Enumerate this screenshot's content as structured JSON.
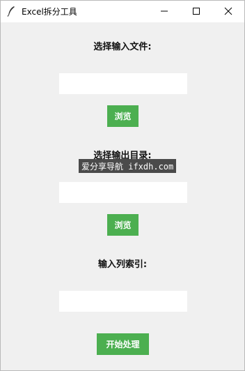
{
  "window": {
    "title": "Excel拆分工具",
    "icon": "feather-icon",
    "controls": [
      "minimize-icon",
      "maximize-icon",
      "close-icon"
    ]
  },
  "form": {
    "input_file_label": "选择输入文件:",
    "input_file_value": "",
    "browse_input_label": "浏览",
    "output_dir_label": "选择输出目录:",
    "output_dir_value": "",
    "browse_output_label": "浏览",
    "column_index_label": "输入列索引:",
    "column_index_value": "",
    "start_button_label": "开始处理"
  },
  "watermark": "爱分享导航 ifxdh.com",
  "colors": {
    "accent": "#4caf50",
    "background": "#f0f0f0",
    "titlebar": "#ffffff"
  }
}
